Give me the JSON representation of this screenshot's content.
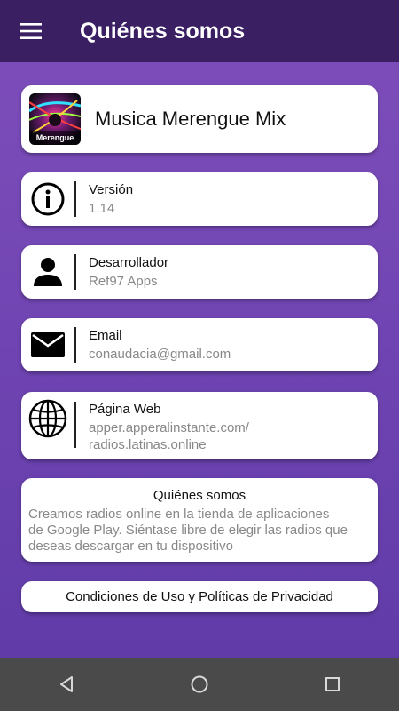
{
  "header": {
    "title": "Quiénes somos",
    "menu_icon": "hamburger-menu-icon"
  },
  "app": {
    "name": "Musica Merengue Mix",
    "logo_text": "Merengue"
  },
  "version": {
    "label": "Versión",
    "value": "1.14",
    "icon": "info-icon"
  },
  "developer": {
    "label": "Desarrollador",
    "value": "Ref97 Apps",
    "icon": "person-icon"
  },
  "email": {
    "label": "Email",
    "value": "conaudacia@gmail.com",
    "icon": "envelope-icon"
  },
  "website": {
    "label": "Página Web",
    "value_line1": "apper.apperalinstante.com/",
    "value_line2": "radios.latinas.online",
    "icon": "globe-icon"
  },
  "about": {
    "title": "Quiénes somos",
    "text_line1": "Creamos radios online en la tienda de aplicaciones",
    "text_line2": "de Google Play. Siéntase libre de elegir las radios que",
    "text_line3": "deseas descargar en tu dispositivo"
  },
  "terms": {
    "label": "Condiciones de Uso y Políticas de Privacidad"
  },
  "navigation": {
    "back_icon": "back-triangle-icon",
    "home_icon": "home-circle-icon",
    "recents_icon": "recents-square-icon"
  },
  "colors": {
    "app_bar": "#3a1f63",
    "background": "#7045b3",
    "nav_bar": "#4a4a4a",
    "card": "#ffffff"
  }
}
